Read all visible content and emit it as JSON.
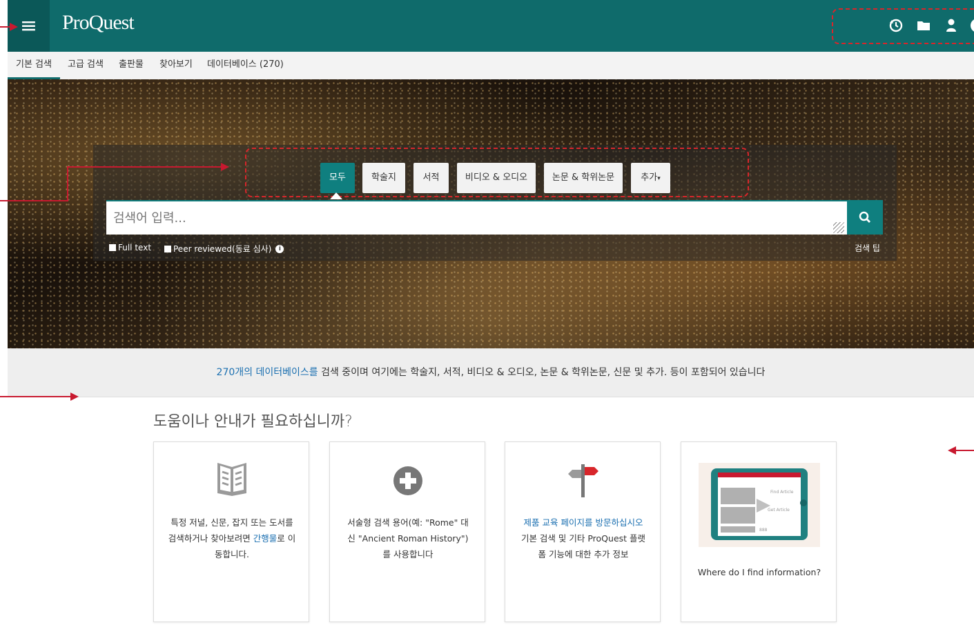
{
  "header": {
    "menu_icon": "hamburger-icon",
    "logo": "ProQuest",
    "icons": [
      "history-icon",
      "folder-icon",
      "user-icon",
      "help-icon"
    ]
  },
  "nav": {
    "tabs": [
      {
        "label": "기본 검색",
        "active": true
      },
      {
        "label": "고급 검색"
      },
      {
        "label": "출판물"
      },
      {
        "label": "찾아보기"
      },
      {
        "label": "데이터베이스 (270)"
      }
    ]
  },
  "search": {
    "types": [
      "모두",
      "학술지",
      "서적",
      "비디오 & 오디오",
      "논문 & 학위논문",
      "추가"
    ],
    "active_type": "모두",
    "placeholder": "검색어 입력...",
    "full_text": "Full text",
    "peer_reviewed": "Peer reviewed(동료 심사)",
    "search_tips": "검색 팁"
  },
  "infobar": {
    "link": "270개의 데이터베이스를",
    "text": " 검색 중이며 여기에는 학술지, 서적, 비디오 & 오디오, 논문 & 학위논문, 신문 및 추가. 등이 포함되어 있습니다"
  },
  "help": {
    "title": "도움이나 안내가 필요하십니까?",
    "cards": [
      {
        "text_before": "특정 저널, 신문, 잡지 또는 도서를 검색하거나 찾아보려면 ",
        "link": "간행물",
        "text_after": "로 이동합니다."
      },
      {
        "text": "서술형 검색 용어(예: \"Rome\" 대신 \"Ancient Roman History\")를 사용합니다"
      },
      {
        "link": "제품 교육 페이지를 방문하십시오",
        "text_after": " 기본 검색 및 기타 ProQuest 플랫폼 기능에 대한 추가 정보"
      },
      {
        "text": "Where do I find information?",
        "thumb_text_1": "Find Article",
        "thumb_text_2": "Get Article",
        "thumb_text_3": "888"
      }
    ]
  },
  "colors": {
    "header": "#0f6b6b",
    "accent": "#0f7f7f",
    "link": "#1a6fb0",
    "annotation": "#d8262b"
  }
}
